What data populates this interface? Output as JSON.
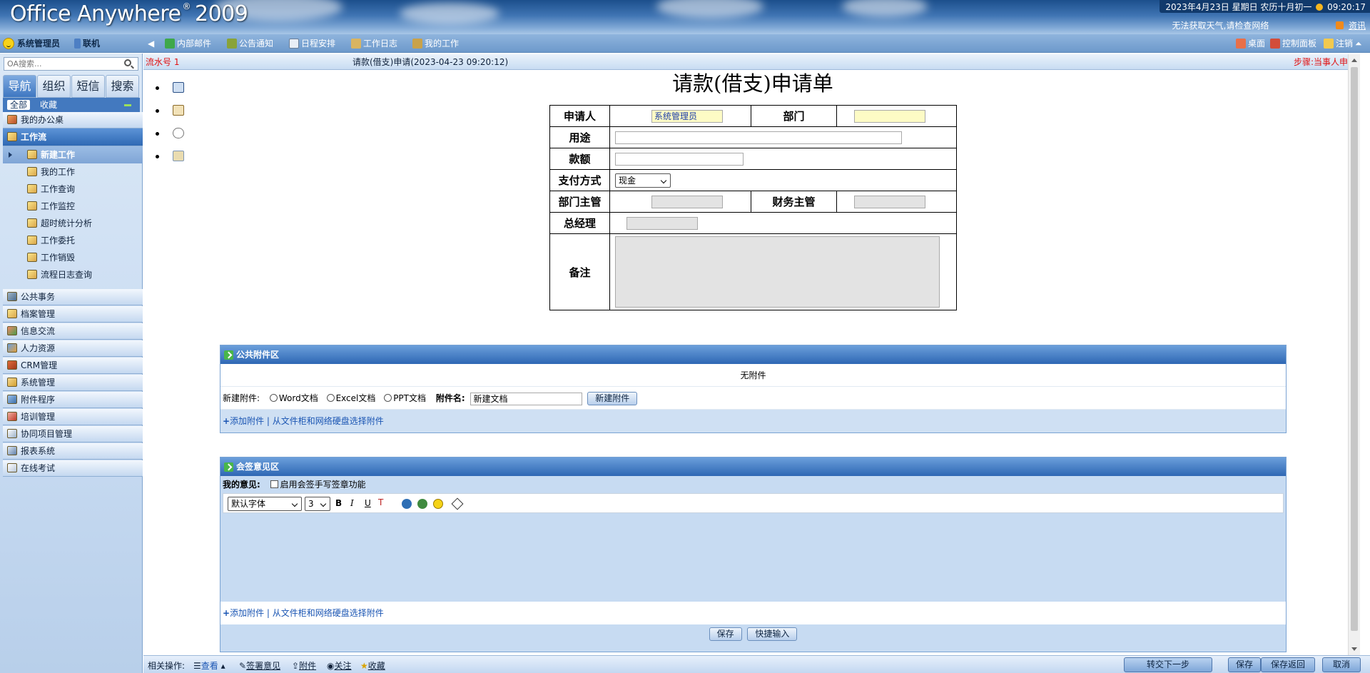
{
  "header": {
    "logo": "Office Anywhere",
    "logo_sup": "®",
    "logo_year": "2009",
    "datetime": "2023年4月23日 星期日 农历十月初一",
    "time": "09:20:17",
    "weather": "无法获取天气,请检查网络",
    "news_link": "资讯"
  },
  "topbar": {
    "user": "系统管理员",
    "status": "联机",
    "items": [
      "内部邮件",
      "公告通知",
      "日程安排",
      "工作日志",
      "我的工作"
    ],
    "right": [
      "桌面",
      "控制面板",
      "注销"
    ]
  },
  "sidebar": {
    "search_placeholder": "OA搜索...",
    "tabs": [
      "导航",
      "组织",
      "短信",
      "搜索"
    ],
    "subtabs": [
      "全部",
      "收藏"
    ],
    "menu_top": "我的办公桌",
    "workflow": "工作流",
    "workflow_items": [
      "新建工作",
      "我的工作",
      "工作查询",
      "工作监控",
      "超时统计分析",
      "工作委托",
      "工作销毁",
      "流程日志查询"
    ],
    "menu_rest": [
      "公共事务",
      "档案管理",
      "信息交流",
      "人力资源",
      "CRM管理",
      "系统管理",
      "附件程序",
      "培训管理",
      "协同项目管理",
      "报表系统",
      "在线考试"
    ]
  },
  "infobar": {
    "serial": "流水号 1",
    "title": "请款(借支)申请(2023-04-23 09:20:12)",
    "step": "步骤:当事人申请"
  },
  "form": {
    "title": "请款(借支)申请单",
    "labels": {
      "applicant": "申请人",
      "dept": "部门",
      "purpose": "用途",
      "amount": "款额",
      "paymethod": "支付方式",
      "dept_mgr": "部门主管",
      "fin_mgr": "财务主管",
      "gm": "总经理",
      "remark": "备注"
    },
    "applicant_value": "系统管理员",
    "paymethod_value": "现金"
  },
  "attach_panel": {
    "title": "公共附件区",
    "empty": "无附件",
    "new_label": "新建附件:",
    "radio": [
      "Word文档",
      "Excel文档",
      "PPT文档"
    ],
    "name_label": "附件名:",
    "name_value": "新建文档",
    "new_button": "新建附件",
    "add_link": "添加附件",
    "pick_link": "从文件柜和网络硬盘选择附件"
  },
  "sign_panel": {
    "title": "会签意见区",
    "my_opinion": "我的意见:",
    "handwrite": "启用会签手写签章功能",
    "font_select": "默认字体",
    "size_select": "3",
    "add_link": "添加附件",
    "pick_link": "从文件柜和网络硬盘选择附件",
    "save": "保存",
    "quick": "快捷输入"
  },
  "bottombar": {
    "label": "相关操作:",
    "items": [
      "查看",
      "签署意见",
      "附件",
      "关注",
      "收藏"
    ],
    "buttons": [
      "转交下一步",
      "保存",
      "保存返回",
      "取消"
    ]
  },
  "colors": {
    "header_bg": "#2f63a5",
    "panel_head": "#2e67b4",
    "highlight_red": "#e01010"
  }
}
